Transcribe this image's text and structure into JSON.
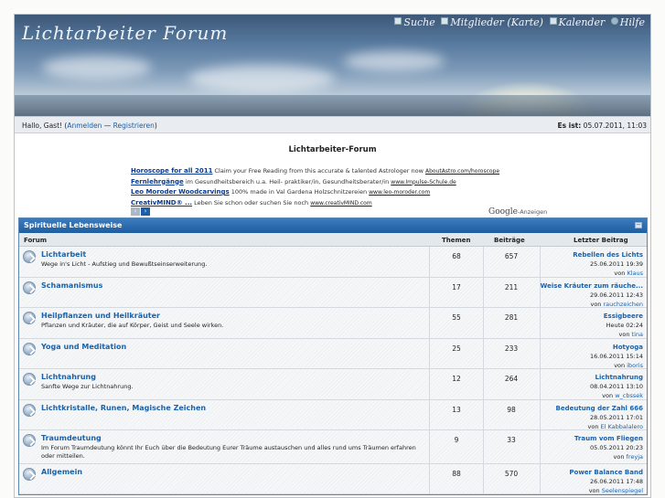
{
  "header": {
    "logo_text": "Lichtarbeiter Forum",
    "nav": [
      {
        "label": "Suche",
        "icon": "search-icon"
      },
      {
        "label": "Mitglieder (Karte)",
        "icon": "members-icon"
      },
      {
        "label": "Kalender",
        "icon": "calendar-icon"
      },
      {
        "label": "Hilfe",
        "icon": "help-icon"
      }
    ]
  },
  "userbar": {
    "greeting_prefix": "Hallo, Gast! (",
    "login_link": "Anmelden",
    "separator": " — ",
    "register_link": "Registrieren",
    "greeting_suffix": ")",
    "time_label": "Es ist:",
    "time_value": "05.07.2011, 11:03"
  },
  "page_title": "Lichtarbeiter-Forum",
  "ads": [
    {
      "headline": "Horoscope for all 2011",
      "text": " Claim your Free Reading from this accurate & talented Astrologer now ",
      "url": "AboutAstro.com/horoscope"
    },
    {
      "headline": "Fernlehrgänge",
      "text": " im Gesundheitsbereich u.a. Heil- praktiker/in, Gesundheitsberater/in ",
      "url": "www.Impulse-Schule.de"
    },
    {
      "headline": "Leo Moroder Woodcarvings",
      "text": " 100% made in Val Gardena Holzschnitzereien ",
      "url": "www.leo-moroder.com"
    },
    {
      "headline": "CreativMIND® ...",
      "text": " Leben Sie schon oder suchen Sie noch ",
      "url": "www.creativMIND.com"
    }
  ],
  "ad_nav": {
    "prev": "‹",
    "next": "›"
  },
  "google_ads": {
    "brand": "Google",
    "suffix": "-Anzeigen"
  },
  "forum": {
    "category": "Spirituelle Lebensweise",
    "collapse": "−",
    "columns": {
      "forum": "Forum",
      "themen": "Themen",
      "beitraege": "Beiträge",
      "letzter": "Letzter Beitrag"
    },
    "rows": [
      {
        "name": "Lichtarbeit",
        "desc": "Wege in's Licht - Aufstieg und Bewußtseinserweiterung.",
        "themen": "68",
        "beitraege": "657",
        "last_title": "Rebellen des Lichts",
        "last_date": "25.06.2011 19:39",
        "by": "von ",
        "last_user": "Klaus"
      },
      {
        "name": "Schamanismus",
        "desc": "",
        "themen": "17",
        "beitraege": "211",
        "last_title": "Weise Kräuter zum räuche...",
        "last_date": "29.06.2011 12:43",
        "by": "von ",
        "last_user": "rauchzeichen"
      },
      {
        "name": "Heilpflanzen und Heilkräuter",
        "desc": "Pflanzen und Kräuter, die auf Körper, Geist und Seele wirken.",
        "themen": "55",
        "beitraege": "281",
        "last_title": "Essigbeere",
        "last_date": "Heute 02:24",
        "by": "von ",
        "last_user": "tina"
      },
      {
        "name": "Yoga und Meditation",
        "desc": "",
        "themen": "25",
        "beitraege": "233",
        "last_title": "Hotyoga",
        "last_date": "16.06.2011 15:14",
        "by": "von ",
        "last_user": "iboris"
      },
      {
        "name": "Lichtnahrung",
        "desc": "Sanfte Wege zur Lichtnahrung.",
        "themen": "12",
        "beitraege": "264",
        "last_title": "Lichtnahrung",
        "last_date": "08.04.2011 13:10",
        "by": "von ",
        "last_user": "w_cbssek"
      },
      {
        "name": "Lichtkristalle, Runen, Magische Zeichen",
        "desc": "",
        "themen": "13",
        "beitraege": "98",
        "last_title": "Bedeutung der Zahl 666",
        "last_date": "28.05.2011 17:01",
        "by": "von ",
        "last_user": "El Kabbalalero"
      },
      {
        "name": "Traumdeutung",
        "desc": "Im Forum Traumdeutung könnt Ihr Euch über die Bedeutung Eurer Träume austauschen und alles rund ums Träumen erfahren oder mitteilen.",
        "themen": "9",
        "beitraege": "33",
        "last_title": "Traum vom Fliegen",
        "last_date": "05.05.2011 20:23",
        "by": "von ",
        "last_user": "freyja"
      },
      {
        "name": "Allgemein",
        "desc": "",
        "themen": "88",
        "beitraege": "570",
        "last_title": "Power Balance Band",
        "last_date": "26.06.2011 17:48",
        "by": "von ",
        "last_user": "Seelenspiegel"
      }
    ]
  },
  "colors": {
    "accent": "#1a62ab",
    "category_bar": "#1e5e9f",
    "userbar": "#e9edf1"
  }
}
